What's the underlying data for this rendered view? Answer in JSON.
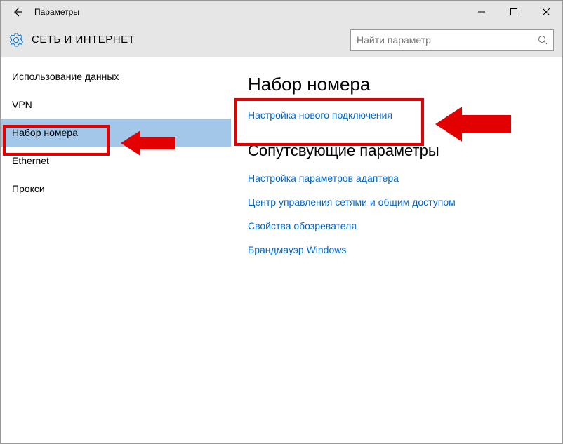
{
  "titlebar": {
    "title": "Параметры"
  },
  "header": {
    "title": "СЕТЬ И ИНТЕРНЕТ",
    "search_placeholder": "Найти параметр"
  },
  "sidebar": {
    "items": [
      {
        "label": "Использование данных"
      },
      {
        "label": "VPN"
      },
      {
        "label": "Набор номера"
      },
      {
        "label": "Ethernet"
      },
      {
        "label": "Прокси"
      }
    ]
  },
  "main": {
    "heading": "Набор номера",
    "primary_link": "Настройка нового подключения",
    "related_heading": "Сопутсвующие параметры",
    "related_links": [
      "Настройка параметров адаптера",
      "Центр управления сетями и общим доступом",
      "Свойства обозревателя",
      "Брандмауэр Windows"
    ]
  }
}
